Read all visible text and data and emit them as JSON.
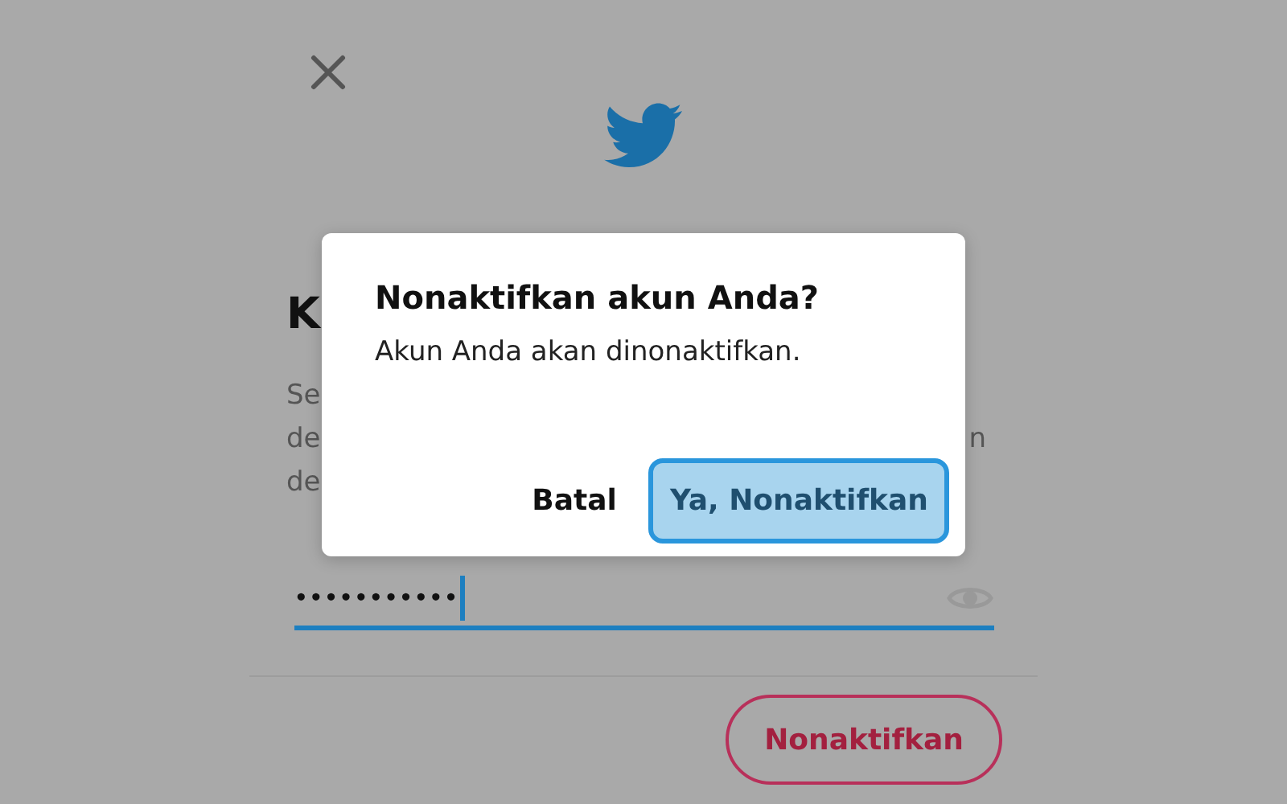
{
  "background": {
    "heading": "K",
    "description_lines": [
      {
        "left": "Se"
      },
      {
        "left": "de",
        "right": "n"
      },
      {
        "left": "de"
      }
    ],
    "password_field": {
      "value": "•••••••••••",
      "focused": true
    },
    "deactivate_button": "Nonaktifkan"
  },
  "dialog": {
    "title": "Nonaktifkan akun Anda?",
    "message": "Akun Anda akan dinonaktifkan.",
    "buttons": [
      {
        "label": "Batal",
        "kind": "plain"
      },
      {
        "label": "Ya, Nonaktifkan",
        "kind": "primary"
      }
    ]
  }
}
